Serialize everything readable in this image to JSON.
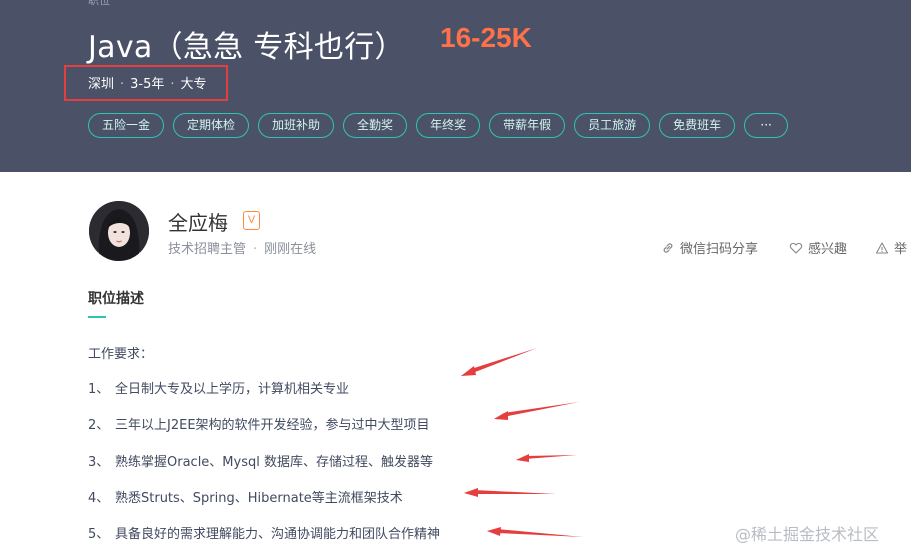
{
  "header": {
    "crumb": "职位",
    "job_title": "Java（急急 专科也行）",
    "salary": "16-25K",
    "city": "深圳",
    "experience": "3-5年",
    "education": "大专"
  },
  "benefits": [
    "五险一金",
    "定期体检",
    "加班补助",
    "全勤奖",
    "年终奖",
    "带薪年假",
    "员工旅游",
    "免费班车",
    "···"
  ],
  "recruiter": {
    "name": "全应梅",
    "badge": "V",
    "title": "技术招聘主管",
    "status": "刚刚在线"
  },
  "actions": {
    "share": "微信扫码分享",
    "like": "感兴趣",
    "report": "举"
  },
  "description": {
    "section_title": "职位描述",
    "heading": "工作要求：",
    "items": [
      {
        "num": "1、",
        "text": "全日制大专及以上学历，计算机相关专业"
      },
      {
        "num": "2、",
        "text": "三年以上J2EE架构的软件开发经验，参与过中大型项目"
      },
      {
        "num": "3、",
        "text": "熟练掌握Oracle、Mysql 数据库、存储过程、触发器等"
      },
      {
        "num": "4、",
        "text": "熟悉Struts、Spring、Hibernate等主流框架技术"
      },
      {
        "num": "5、",
        "text": "具备良好的需求理解能力、沟通协调能力和团队合作精神"
      }
    ]
  },
  "colors": {
    "banner": "#4b5268",
    "salary": "#ff7149",
    "accent": "#2fc3b3",
    "annotation": "#e53e3e"
  },
  "watermark": "@稀土掘金技术社区"
}
